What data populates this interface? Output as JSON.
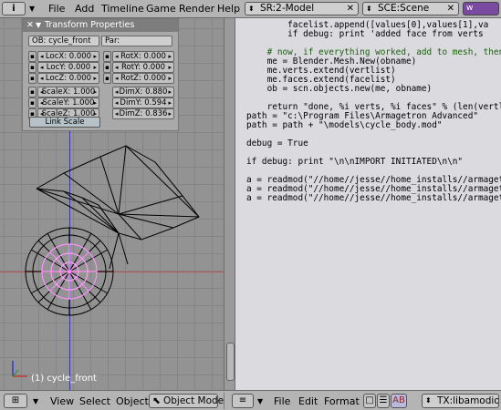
{
  "topbar": {
    "menu_icon": "i",
    "menus": [
      "File",
      "Add",
      "Timeline",
      "Game",
      "Render",
      "Help"
    ],
    "screen": "SR:2-Model",
    "scene": "SCE:Scene"
  },
  "panel": {
    "title": "Transform Properties",
    "ob": "OB: cycle_front",
    "par": "Par:",
    "loc": [
      "LocX: 0.000",
      "LocY: 0.000",
      "LocZ: 0.000"
    ],
    "rot": [
      "RotX: 0.000",
      "RotY: 0.000",
      "RotZ: 0.000"
    ],
    "scale": [
      "ScaleX: 1.000",
      "ScaleY: 1.000",
      "ScaleZ: 1.000"
    ],
    "dim": [
      "DimX: 0.880",
      "DimY: 0.594",
      "DimZ: 0.836"
    ],
    "link_scale": "Link Scale"
  },
  "viewport": {
    "object_label": "(1) cycle_front"
  },
  "code": [
    {
      "text": "        facelist.append([values[0],values[1],va",
      "cls": "c-default"
    },
    {
      "text": "        if debug: print 'added face from verts",
      "cls": "c-default"
    },
    {
      "text": "",
      "cls": "c-default"
    },
    {
      "text": "    # now, if everything worked, add to mesh, then",
      "cls": "c-comment"
    },
    {
      "text": "    me = Blender.Mesh.New(obname)",
      "cls": "c-default"
    },
    {
      "text": "    me.verts.extend(vertlist)",
      "cls": "c-default"
    },
    {
      "text": "    me.faces.extend(facelist)",
      "cls": "c-default"
    },
    {
      "text": "    ob = scn.objects.new(me, obname)",
      "cls": "c-default"
    },
    {
      "text": "",
      "cls": "c-default"
    },
    {
      "text": "    return \"done, %i verts, %i faces\" % (len(vertli",
      "cls": "c-default"
    },
    {
      "text": "path = \"c:\\Program Files\\Armagetron Advanced\"",
      "cls": "c-default"
    },
    {
      "text": "path = path + \"\\models\\cycle_body.mod\"",
      "cls": "c-default"
    },
    {
      "text": "",
      "cls": "c-default"
    },
    {
      "text": "debug = True",
      "cls": "c-default"
    },
    {
      "text": "",
      "cls": "c-default"
    },
    {
      "text": "if debug: print \"\\n\\nIMPORT INITIATED\\n\\n\"",
      "cls": "c-default"
    },
    {
      "text": "",
      "cls": "c-default"
    },
    {
      "text": "a = readmod(\"//home//jesse//home_installs//armagetr",
      "cls": "c-default"
    },
    {
      "text": "a = readmod(\"//home//jesse//home_installs//armagetr",
      "cls": "c-default"
    },
    {
      "text": "a = readmod(\"//home//jesse//home_installs//armagetr",
      "cls": "c-default"
    }
  ],
  "bottombar": {
    "view": "View",
    "select": "Select",
    "object": "Object",
    "mode": "Object Mode",
    "file": "File",
    "edit": "Edit",
    "format": "Format",
    "text_block": "TX:libamodio.py"
  },
  "colors": {
    "wire": "#000000",
    "selected_wire": "#ff9cff",
    "x_axis": "#b4545b",
    "z_axis": "#3a36a6"
  }
}
